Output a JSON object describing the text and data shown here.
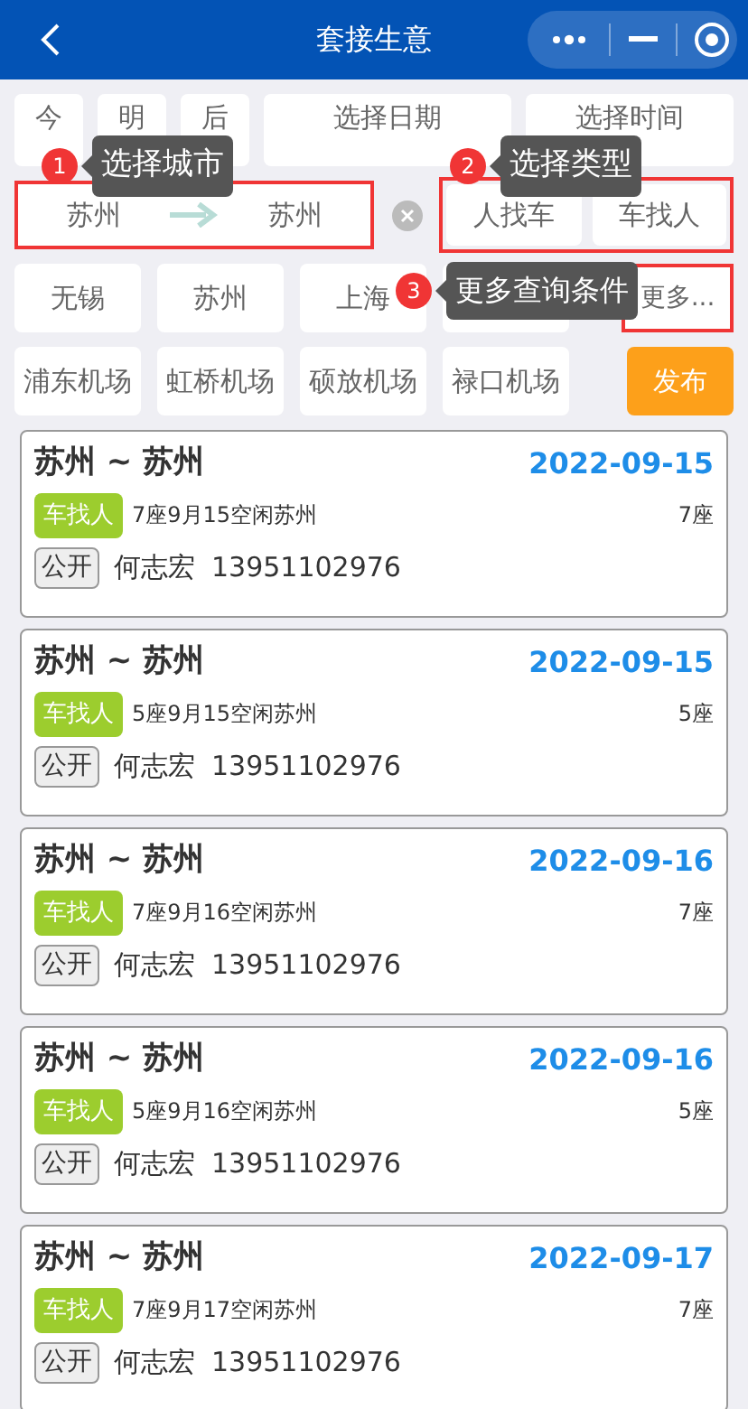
{
  "header": {
    "title": "套接生意"
  },
  "date_row": [
    "今",
    "明",
    "后",
    "选择日期",
    "选择时间"
  ],
  "route": {
    "from": "苏州",
    "to": "苏州"
  },
  "types": [
    {
      "label": "人找车",
      "selected": false
    },
    {
      "label": "车找人",
      "selected": false
    }
  ],
  "cities": [
    "无锡",
    "苏州",
    "上海"
  ],
  "more": "更多...",
  "airports": [
    "浦东机场",
    "虹桥机场",
    "硕放机场",
    "禄口机场"
  ],
  "publish": "发布",
  "guide_steps": [
    {
      "number": "1",
      "text": "选择城市"
    },
    {
      "number": "2",
      "text": "选择类型"
    },
    {
      "number": "3",
      "text": "更多查询条件"
    }
  ],
  "listings": [
    {
      "route": "苏州 ~ 苏州",
      "date": "2022-09-15",
      "tag": "车找人",
      "desc": "7座9月15空闲苏州",
      "seats": "7座",
      "visibility": "公开",
      "name": "何志宏",
      "phone": "13951102976"
    },
    {
      "route": "苏州 ~ 苏州",
      "date": "2022-09-15",
      "tag": "车找人",
      "desc": "5座9月15空闲苏州",
      "seats": "5座",
      "visibility": "公开",
      "name": "何志宏",
      "phone": "13951102976"
    },
    {
      "route": "苏州 ~ 苏州",
      "date": "2022-09-16",
      "tag": "车找人",
      "desc": "7座9月16空闲苏州",
      "seats": "7座",
      "visibility": "公开",
      "name": "何志宏",
      "phone": "13951102976"
    },
    {
      "route": "苏州 ~ 苏州",
      "date": "2022-09-16",
      "tag": "车找人",
      "desc": "5座9月16空闲苏州",
      "seats": "5座",
      "visibility": "公开",
      "name": "何志宏",
      "phone": "13951102976"
    },
    {
      "route": "苏州 ~ 苏州",
      "date": "2022-09-17",
      "tag": "车找人",
      "desc": "7座9月17空闲苏州",
      "seats": "7座",
      "visibility": "公开",
      "name": "何志宏",
      "phone": "13951102976"
    }
  ]
}
